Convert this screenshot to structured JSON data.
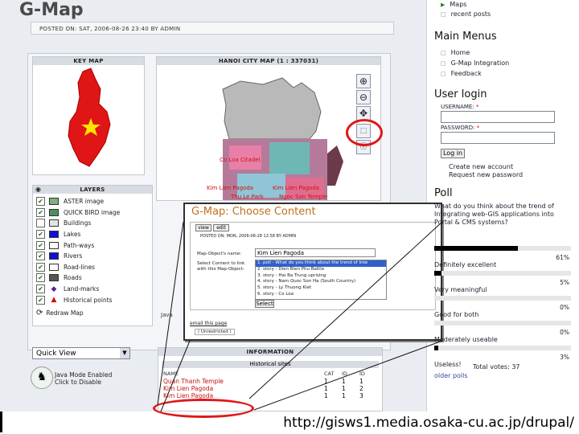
{
  "page": {
    "title": "G-Map",
    "posted": "POSTED ON: SAT, 2006-08-26 23:40 BY ADMIN"
  },
  "keymap": {
    "header": "KEY MAP"
  },
  "citymap": {
    "header": "HANOI CITY MAP (1 : 337031)",
    "labels": [
      "Co Loa Citadel",
      "Kim Lien Pagoda",
      "Kim Lien Pagoda",
      "Thu Le Park",
      "Ngoc Son Temple"
    ],
    "tools": [
      "zoom-in-icon",
      "zoom-out-icon",
      "pan-icon",
      "select-icon",
      "info-icon"
    ]
  },
  "layers": {
    "header": "LAYERS",
    "items": [
      {
        "label": "ASTER image",
        "checked": true,
        "swatch": "#7fb07f"
      },
      {
        "label": "QUICK BIRD image",
        "checked": true,
        "swatch": "#4f8f5f"
      },
      {
        "label": "Buildings",
        "checked": false,
        "swatch": "#e4e4e4"
      },
      {
        "label": "Lakes",
        "checked": true,
        "swatch": "#1010d8"
      },
      {
        "label": "Path-ways",
        "checked": true,
        "swatch": "#ffffff"
      },
      {
        "label": "Rivers",
        "checked": true,
        "swatch": "#1010d8"
      },
      {
        "label": "Road-lines",
        "checked": true,
        "swatch": "#ffffff"
      },
      {
        "label": "Roads",
        "checked": true,
        "swatch": "#555555"
      },
      {
        "label": "Land-marks",
        "checked": true,
        "swatch": "diamond"
      },
      {
        "label": "Historical points",
        "checked": true,
        "swatch": "triangle"
      }
    ],
    "redraw": "Redraw Map"
  },
  "quickview": {
    "value": "Quick View"
  },
  "java": {
    "line1": "Java Mode Enabled",
    "line2": "Click to Disable"
  },
  "information": {
    "header": "INFORMATION",
    "sites_header": "Historical sites",
    "columns": [
      "NAME",
      "CAT",
      "ID",
      "ID"
    ],
    "rows": [
      {
        "name": "Quan Thanh Temple",
        "cat": "1",
        "id1": "1",
        "id2": "1"
      },
      {
        "name": "Kim Lien Pagoda",
        "cat": "1",
        "id1": "1",
        "id2": "2"
      },
      {
        "name": "Kim Lien Pagoda",
        "cat": "1",
        "id1": "1",
        "id2": "3"
      }
    ]
  },
  "popup": {
    "title": "G-Map: Choose Content",
    "tabs": [
      "view",
      "edit"
    ],
    "posted": "POSTED ON: MON, 2006-08-28 12:58 BY ADMIN",
    "field_label": "Map-Object's name:",
    "field_value": "Kim Lien Pagoda",
    "select_label": "Select Content to link with this Map-Object:",
    "options": [
      "1. poll - What do you think about the trend of Inte",
      "2. story - Dien Bien Phu Battle",
      "3. story - Hai Ba Trung uprising",
      "4. story - Nam Quoc Son Ha (South Country)",
      "5. story - Ly Thuong Kiet",
      "6. story - Co Loa"
    ],
    "button": "Select",
    "email": "email this page",
    "unrestricted": "( Unrestricted )"
  },
  "sidebar": {
    "top_links": [
      "Maps",
      "recent posts"
    ],
    "main_menus": {
      "title": "Main Menus",
      "items": [
        "Home",
        "G-Map Integration",
        "Feedback"
      ]
    },
    "login": {
      "title": "User login",
      "username_label": "USERNAME:",
      "password_label": "PASSWORD:",
      "button": "Log in",
      "create": "Create new account",
      "request": "Request new password"
    },
    "poll": {
      "title": "Poll",
      "question": "What do you think about the trend of Integrating web-GIS applications into Portal & CMS systems?",
      "options": [
        {
          "label": "Definitely excellent",
          "percent": 61
        },
        {
          "label": "Very meaningful",
          "percent": 5
        },
        {
          "label": "Good for both",
          "percent": 0
        },
        {
          "label": "Moderately useable",
          "percent": 0
        },
        {
          "label": "Useless!",
          "percent": 3
        }
      ],
      "pct_labels": [
        "61%",
        "5%",
        "0%",
        "0%",
        "3%"
      ],
      "total": "Total votes: 37",
      "older": "older polls"
    }
  },
  "footer": {
    "url": "http://gisws1.media.osaka-cu.ac.jp/drupal/"
  }
}
